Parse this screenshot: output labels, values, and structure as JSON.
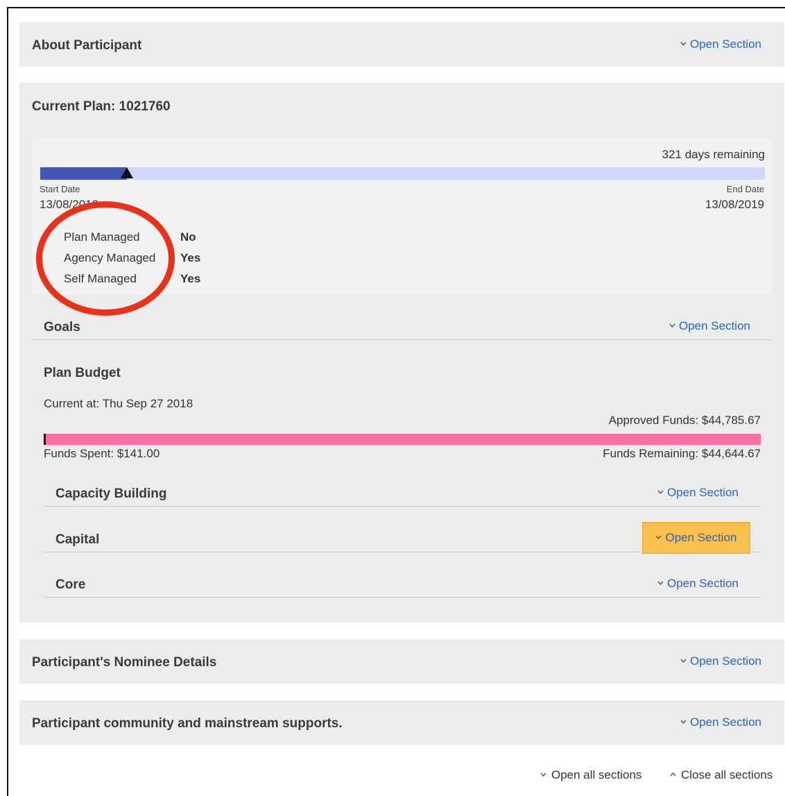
{
  "sections": {
    "about": {
      "title": "About Participant",
      "action": "Open Section"
    },
    "current_plan": {
      "title": "Current Plan: 1021760",
      "days_remaining": "321 days remaining",
      "start_label": "Start Date",
      "start_value": "13/08/2018",
      "end_label": "End Date",
      "end_value": "13/08/2019",
      "progress_fraction": 0.12,
      "management": [
        {
          "label": "Plan Managed",
          "value": "No"
        },
        {
          "label": "Agency Managed",
          "value": "Yes"
        },
        {
          "label": "Self Managed",
          "value": "Yes"
        }
      ]
    },
    "goals": {
      "title": "Goals",
      "action": "Open Section"
    },
    "plan_budget": {
      "title": "Plan Budget",
      "current_at": "Current at: Thu Sep 27 2018",
      "approved": "Approved Funds: $44,785.67",
      "spent": "Funds Spent: $141.00",
      "remaining": "Funds Remaining: $44,644.67",
      "categories": [
        {
          "title": "Capacity Building",
          "action": "Open Section"
        },
        {
          "title": "Capital",
          "action": "Open Section"
        },
        {
          "title": "Core",
          "action": "Open Section"
        }
      ]
    },
    "nominee": {
      "title": "Participant's Nominee Details",
      "action": "Open Section"
    },
    "community": {
      "title": "Participant community and mainstream supports.",
      "action": "Open Section"
    }
  },
  "footer": {
    "open_all": "Open all sections",
    "close_all": "Close all sections"
  },
  "colors": {
    "link": "#2a66b8",
    "plan_progress": "#4355b5",
    "budget_bar": "#ff6fa6",
    "highlight": "#f8c04f",
    "annotation_ring": "#e8321a"
  }
}
